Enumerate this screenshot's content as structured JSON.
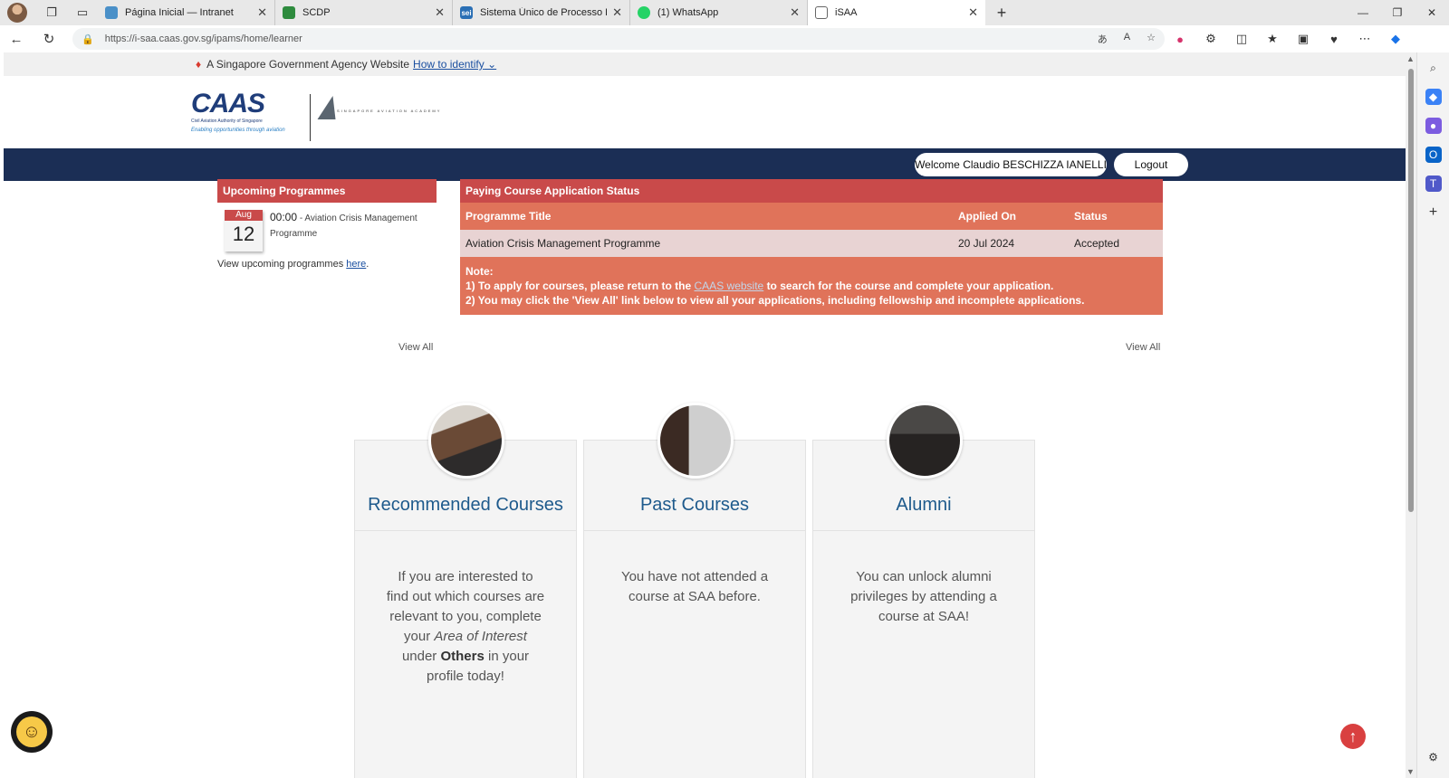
{
  "browser": {
    "tabs": [
      {
        "title": "Página Inicial — Intranet",
        "favicon_color": "#4a90c8"
      },
      {
        "title": "SCDP",
        "favicon_color": "#2e8b3e"
      },
      {
        "title": "Sistema Único de Processo Eletrô",
        "favicon_color": "#2a6fb5",
        "favicon_text": "sei"
      },
      {
        "title": "(1) WhatsApp",
        "favicon_color": "#25d366"
      },
      {
        "title": "iSAA",
        "favicon_color": "#ffffff",
        "active": true
      }
    ],
    "url": "https://i-saa.caas.gov.sg/ipams/home/learner"
  },
  "gov_banner": {
    "text": "A Singapore Government Agency Website",
    "link": "How to identify"
  },
  "logos": {
    "caas_main": "CAAS",
    "caas_sub": "Civil Aviation Authority of Singapore",
    "caas_tag": "Enabling opportunities through aviation",
    "saa_text": "SINGAPORE AVIATION ACADEMY"
  },
  "nav": {
    "welcome": "Welcome Claudio BESCHIZZA IANELLI",
    "logout": "Logout"
  },
  "upcoming": {
    "header": "Upcoming Programmes",
    "event_month": "Aug",
    "event_day": "12",
    "event_time": "00:00",
    "event_title": "- Aviation Crisis Management Programme",
    "footer_text": "View upcoming programmes",
    "footer_link": "here"
  },
  "status": {
    "title": "Paying Course Application Status",
    "columns": [
      "Programme Title",
      "Applied On",
      "Status"
    ],
    "rows": [
      {
        "title": "Aviation Crisis Management Programme",
        "applied": "20 Jul 2024",
        "status": "Accepted"
      }
    ],
    "note_label": "Note:",
    "note1_pre": "1) To apply for courses, please return to the",
    "note1_link": "CAAS website",
    "note1_post": "to search for the course and complete your application.",
    "note2": "2) You may click the 'View All' link below to view all your applications, including fellowship and incomplete applications."
  },
  "view_all_left": "View All",
  "view_all_right": "View All",
  "cards": {
    "recommended": {
      "title": "Recommended Courses",
      "b1": "If you are interested to find out which courses are relevant to you, complete your",
      "b2": "Area of Interest",
      "b3": "under",
      "b4": "Others",
      "b5": "in your profile today!"
    },
    "past": {
      "title": "Past Courses",
      "body": "You have not attended a course at SAA before."
    },
    "alumni": {
      "title": "Alumni",
      "body": "You can unlock alumni privileges by attending a course at SAA!"
    }
  }
}
